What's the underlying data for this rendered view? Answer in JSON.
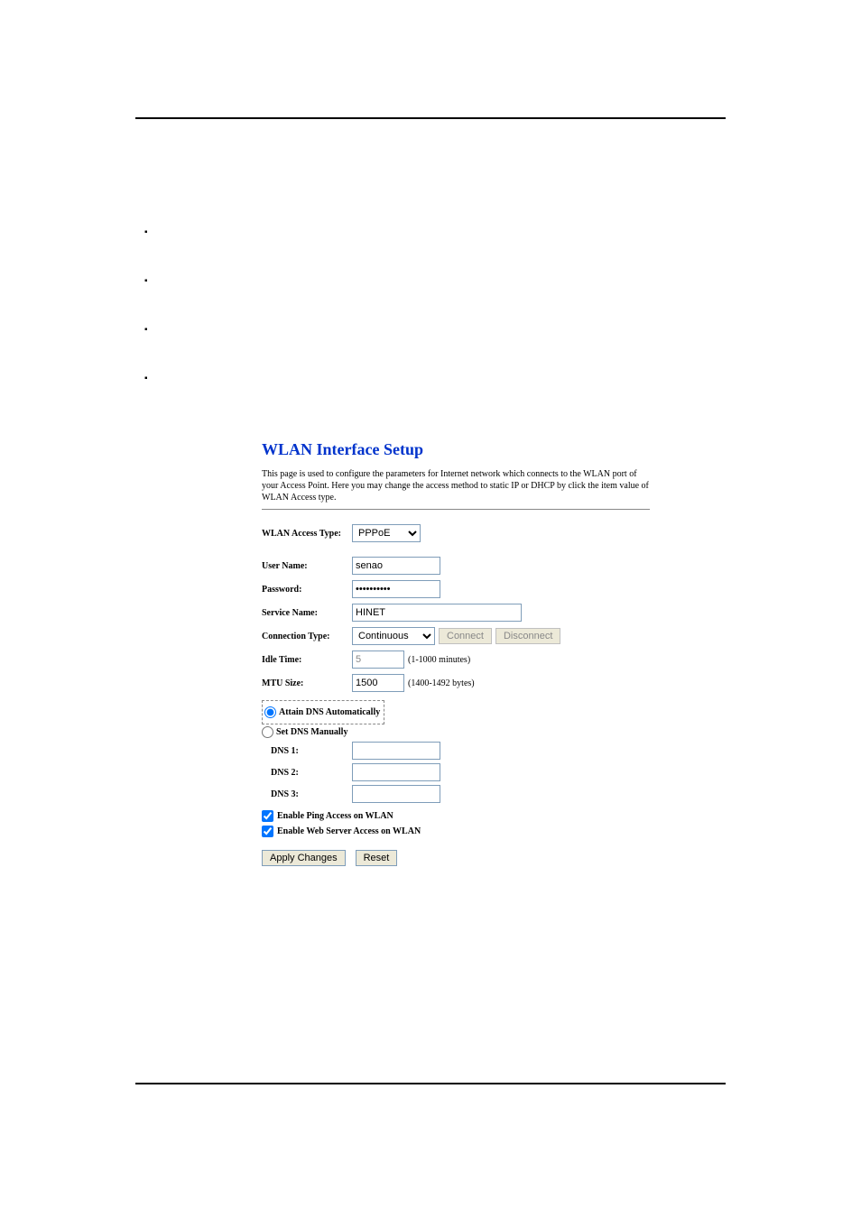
{
  "page_title": "WLAN Interface Setup",
  "description": "This page is used to configure the parameters for Internet network which connects to the WLAN port of your Access Point. Here you may change the access method to static IP or DHCP by click the item value of WLAN Access type.",
  "labels": {
    "access_type": "WLAN Access Type:",
    "user_name": "User Name:",
    "password": "Password:",
    "service_name": "Service Name:",
    "connection_type": "Connection Type:",
    "idle_time": "Idle Time:",
    "mtu_size": "MTU Size:",
    "attain_dns": "Attain DNS Automatically",
    "set_dns": "Set DNS Manually",
    "dns1": "DNS 1:",
    "dns2": "DNS 2:",
    "dns3": "DNS 3:",
    "enable_ping": "Enable Ping Access on WLAN",
    "enable_web": "Enable Web Server Access on WLAN"
  },
  "values": {
    "access_type": "PPPoE",
    "user_name": "senao",
    "password": "••••••••••",
    "service_name": "HINET",
    "connection_type": "Continuous",
    "idle_time": "5",
    "mtu_size": "1500",
    "dns1": "",
    "dns2": "",
    "dns3": ""
  },
  "ranges": {
    "idle_time": "(1-1000 minutes)",
    "mtu_size": "(1400-1492 bytes)"
  },
  "buttons": {
    "connect": "Connect",
    "disconnect": "Disconnect",
    "apply": "Apply Changes",
    "reset": "Reset"
  },
  "checkboxes": {
    "enable_ping": true,
    "enable_web": true
  },
  "radio": {
    "dns_auto": true
  }
}
